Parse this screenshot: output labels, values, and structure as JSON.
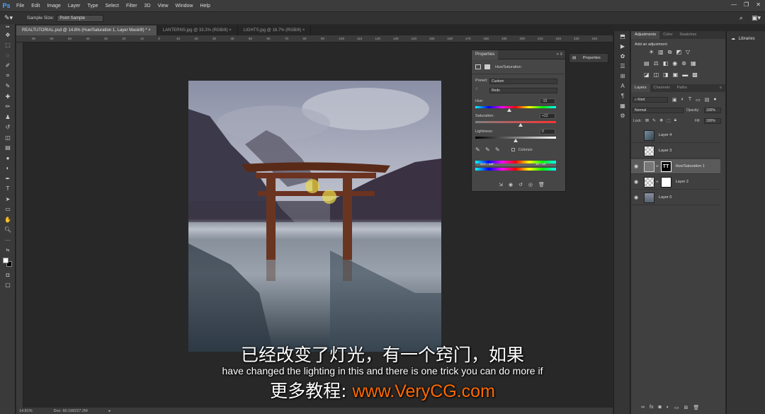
{
  "app": {
    "logo": "Ps"
  },
  "menu": [
    "File",
    "Edit",
    "Image",
    "Layer",
    "Type",
    "Select",
    "Filter",
    "3D",
    "View",
    "Window",
    "Help"
  ],
  "window_controls": [
    "—",
    "❐",
    "✕"
  ],
  "options": {
    "sample_size_label": "Sample Size:",
    "sample_size_value": "Point Sample"
  },
  "tabs": [
    {
      "label": "REALTUTORIAL.psd @ 14.8% (Hue/Saturation 1, Layer Mask/8) *"
    },
    {
      "label": "LANTERNS.jpg @ 33.3% (RGB/8)"
    },
    {
      "label": "LIGHTS.jpg @ 16.7% (RGB/8)"
    }
  ],
  "tab_close": "×",
  "ruler_ticks": [
    "90",
    "60",
    "50",
    "40",
    "30",
    "20",
    "10",
    "0",
    "10",
    "20",
    "30",
    "40",
    "50",
    "60",
    "70",
    "80",
    "90",
    "100",
    "110",
    "120",
    "130",
    "140",
    "150",
    "160",
    "170",
    "180",
    "190",
    "200",
    "210",
    "220",
    "230",
    "240"
  ],
  "status": {
    "zoom": "14.81%",
    "doc": "Doc: 60.1M/227.2M"
  },
  "subtitles": {
    "cn1": "已经改变了灯光，有一个窍门，如果",
    "en": "have changed the lighting in this and there is one trick you can do more if",
    "cn2_prefix": "更多教程: ",
    "cn2_url": "www.VeryCG.com"
  },
  "properties": {
    "title": "Properties",
    "panel_name": "Hue/Saturation",
    "preset_label": "Preset:",
    "preset_value": "Custom",
    "channel_value": "Reds",
    "hue_label": "Hue:",
    "hue_value": "-15",
    "saturation_label": "Saturation:",
    "saturation_value": "+12",
    "lightness_label": "Lightness:",
    "lightness_value": "0",
    "colorize_label": "Colorize",
    "range_left": "315° / 345°",
    "range_right": "15° \\ 45°"
  },
  "properties_dock": {
    "label": "Properties"
  },
  "adjustments": {
    "tabs": [
      "Adjustments",
      "Color",
      "Swatches"
    ],
    "add_label": "Add an adjustment"
  },
  "libraries": {
    "label": "Libraries"
  },
  "layers_panel": {
    "tabs": [
      "Layers",
      "Channels",
      "Paths"
    ],
    "kind_label": "Kind",
    "blend_mode": "Normal",
    "opacity_label": "Opacity:",
    "opacity_value": "100%",
    "lock_label": "Lock:",
    "fill_label": "Fill:",
    "fill_value": "100%",
    "layers": [
      {
        "name": "Layer 4",
        "visible": false
      },
      {
        "name": "Layer 3",
        "visible": false
      },
      {
        "name": "Hue/Saturation 1",
        "visible": true,
        "selected": true
      },
      {
        "name": "Layer 2",
        "visible": true
      },
      {
        "name": "Layer 0",
        "visible": true
      }
    ],
    "footer_icons": [
      "link-icon",
      "fx-icon",
      "mask-icon",
      "adjustment-icon",
      "group-icon",
      "new-layer-icon",
      "trash-icon"
    ]
  },
  "colors": {
    "accent": "#ff6a00",
    "panel": "#464646",
    "selected_layer": "#5a5a5a"
  }
}
